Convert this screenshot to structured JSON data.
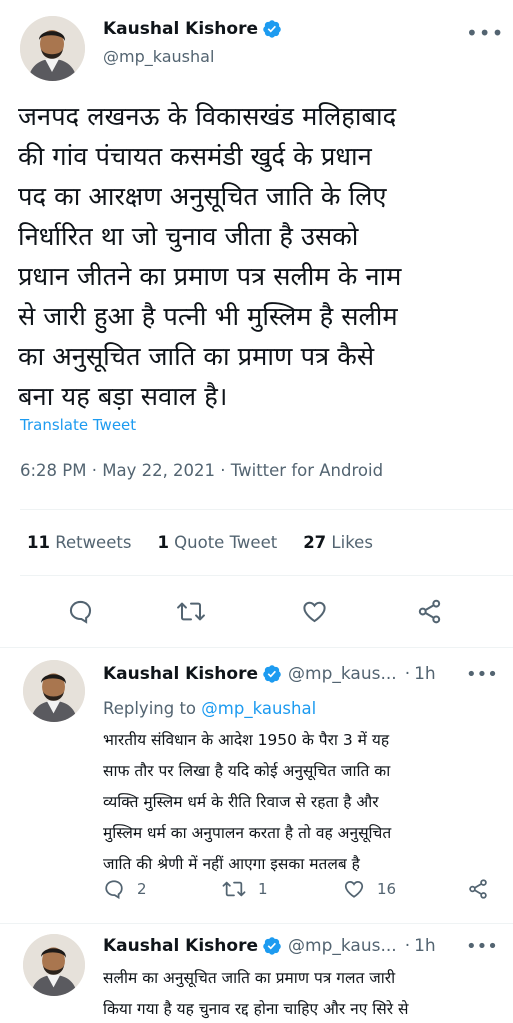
{
  "main_tweet": {
    "author_name": "Kaushal Kishore",
    "author_handle": "@mp_kaushal",
    "more_icon": "more-horizontal-icon",
    "text_lines": [
      "जनपद लखनऊ के विकासखंड मलिहाबाद",
      "की  गांव पंचायत कसमंडी खुर्द के प्रधान",
      "पद का आरक्षण अनुसूचित जाति के लिए",
      "निर्धारित था जो चुनाव जीता है  उसको",
      "प्रधान जीतने का प्रमाण पत्र सलीम के नाम",
      "से जारी हुआ है पत्नी भी मुस्लिम है सलीम",
      "का अनुसूचित जाति का प्रमाण पत्र कैसे",
      "बना यह बड़ा सवाल है।"
    ],
    "translate_label": "Translate Tweet",
    "meta": "6:28 PM · May 22, 2021 · Twitter for Android",
    "stats": {
      "retweets_count": "11",
      "retweets_label": "Retweets",
      "quote_count": "1",
      "quote_label": "Quote Tweet",
      "likes_count": "27",
      "likes_label": "Likes"
    }
  },
  "replies": [
    {
      "author_name": "Kaushal Kishore",
      "author_handle": "@mp_kaus...",
      "time": "1h",
      "replying_prefix": "Replying to",
      "replying_handle": "@mp_kaushal",
      "text_lines": [
        "भारतीय संविधान के आदेश 1950 के पैरा 3 में यह",
        "साफ तौर पर लिखा है यदि कोई अनुसूचित जाति का",
        "व्यक्ति मुस्लिम धर्म के रीति रिवाज से रहता है और",
        "मुस्लिम धर्म का अनुपालन करता है तो वह अनुसूचित",
        "जाति की श्रेणी में नहीं आएगा इसका मतलब है"
      ],
      "reply_count": "2",
      "retweet_count": "1",
      "like_count": "16"
    },
    {
      "author_name": "Kaushal Kishore",
      "author_handle": "@mp_kaus...",
      "time": "1h",
      "text_lines": [
        "सलीम का अनुसूचित जाति का प्रमाण पत्र गलत जारी",
        "किया गया है यह चुनाव रद्द होना चाहिए और नए सिरे से"
      ]
    }
  ],
  "colors": {
    "accent": "#1d9bf0",
    "secondary_text": "#536471",
    "primary_text": "#0f1419",
    "divider": "#eff3f4"
  }
}
